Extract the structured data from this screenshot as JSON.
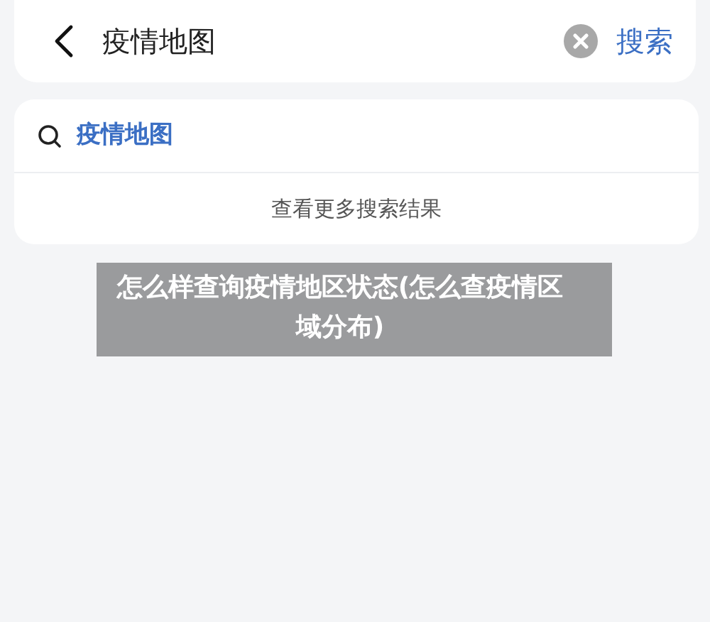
{
  "search_bar": {
    "value": "疫情地图",
    "action": "搜索"
  },
  "suggestions": [
    {
      "text": "疫情地图"
    }
  ],
  "more_results": "查看更多搜索结果",
  "caption_overlay": "怎么样查询疫情地区状态(怎么查疫情区域分布)"
}
